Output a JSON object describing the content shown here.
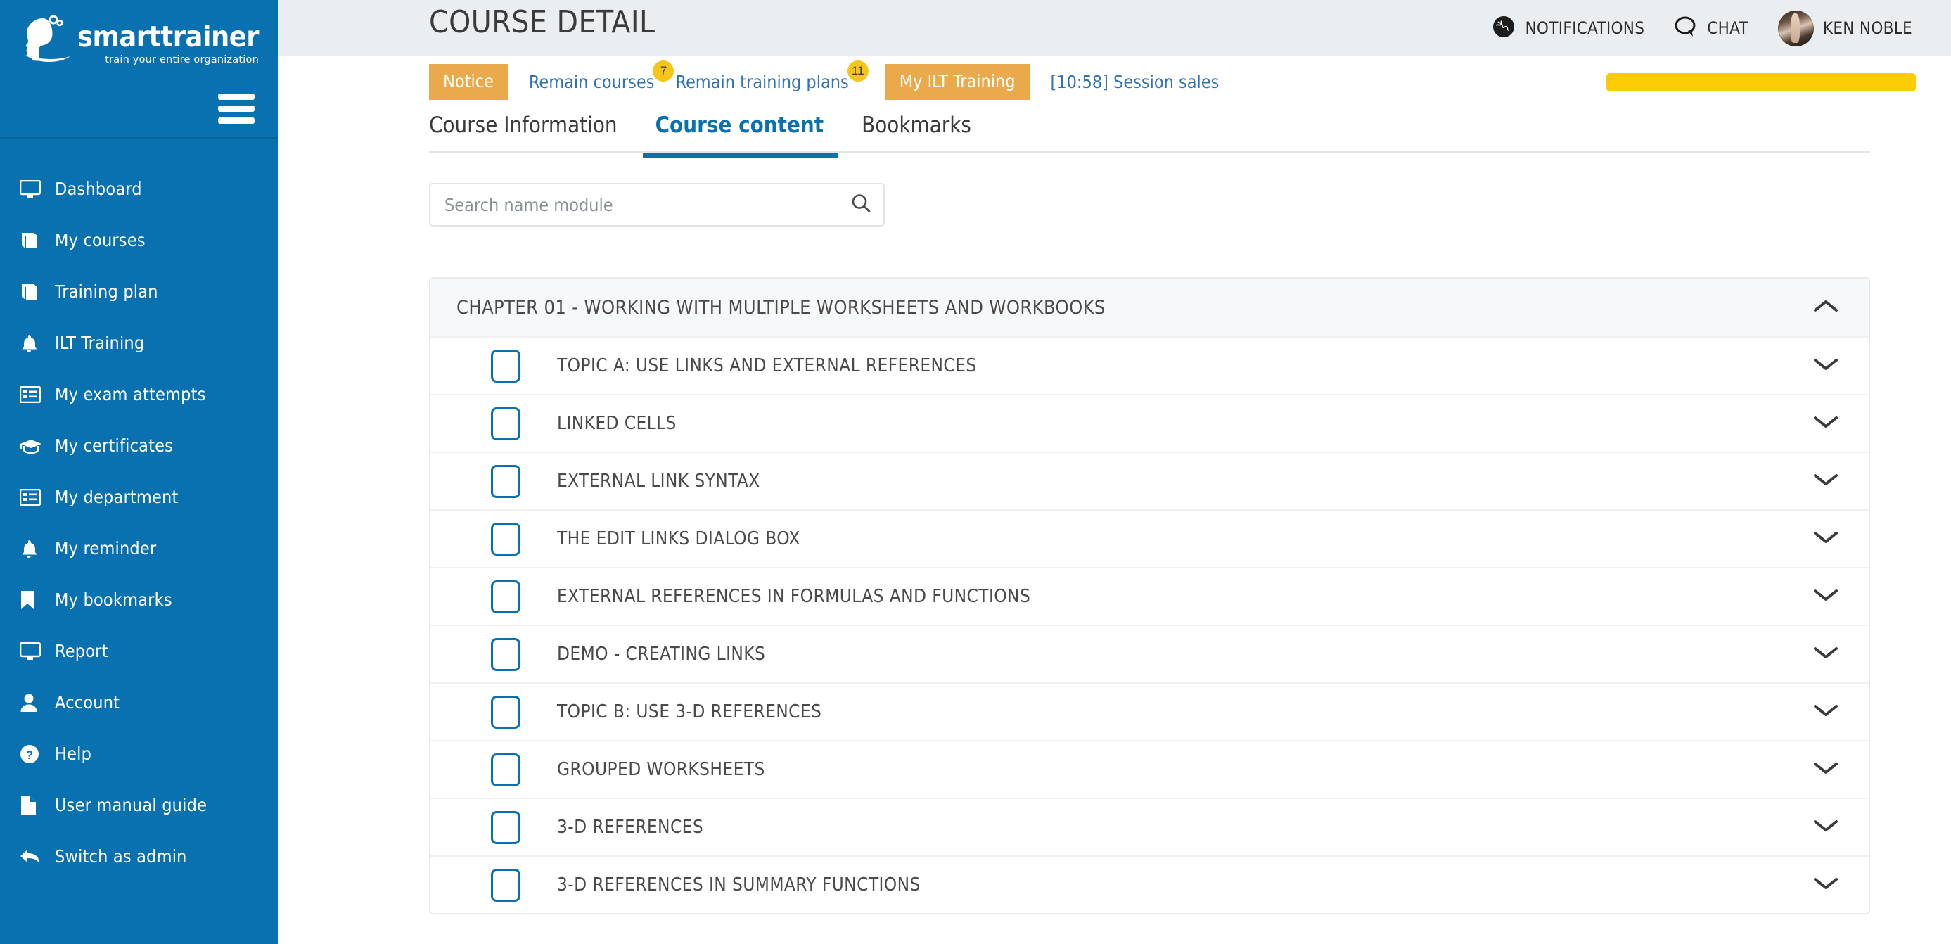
{
  "brand": {
    "name": "smarttrainer",
    "tagline": "train your entire organization"
  },
  "sidebar": {
    "items": [
      {
        "label": "Dashboard",
        "icon": "monitor-icon"
      },
      {
        "label": "My courses",
        "icon": "book-icon"
      },
      {
        "label": "Training plan",
        "icon": "book-icon"
      },
      {
        "label": "ILT Training",
        "icon": "bell-icon"
      },
      {
        "label": "My exam attempts",
        "icon": "list-icon"
      },
      {
        "label": "My certificates",
        "icon": "graduation-cap-icon"
      },
      {
        "label": "My department",
        "icon": "list-icon"
      },
      {
        "label": "My reminder",
        "icon": "bell-icon"
      },
      {
        "label": "My bookmarks",
        "icon": "bookmark-icon"
      },
      {
        "label": "Report",
        "icon": "monitor-icon"
      },
      {
        "label": "Account",
        "icon": "user-icon"
      },
      {
        "label": "Help",
        "icon": "question-circle-icon"
      },
      {
        "label": "User manual guide",
        "icon": "file-icon"
      },
      {
        "label": "Switch as admin",
        "icon": "reply-arrow-icon"
      }
    ]
  },
  "header": {
    "title": "COURSE DETAIL",
    "notifications_label": "NOTIFICATIONS",
    "chat_label": "CHAT",
    "user_name": "KEN NOBLE"
  },
  "notice_bar": {
    "notice_label": "Notice",
    "remain_courses_label": "Remain courses",
    "remain_courses_count": "7",
    "remain_training_plans_label": "Remain training plans",
    "remain_training_plans_count": "11",
    "my_ilt_training_label": "My ILT Training",
    "session_label": "[10:58] Session sales"
  },
  "tabs": [
    {
      "label": "Course Information",
      "active": false
    },
    {
      "label": "Course content",
      "active": true
    },
    {
      "label": "Bookmarks",
      "active": false
    }
  ],
  "search": {
    "placeholder": "Search name module",
    "value": ""
  },
  "accordion": {
    "chapter_title": "CHAPTER 01 - WORKING WITH MULTIPLE WORKSHEETS AND WORKBOOKS",
    "chapter_expanded": true,
    "modules": [
      {
        "label": "TOPIC A: USE LINKS AND EXTERNAL REFERENCES",
        "checked": false
      },
      {
        "label": "LINKED CELLS",
        "checked": false
      },
      {
        "label": "EXTERNAL LINK SYNTAX",
        "checked": false
      },
      {
        "label": "THE EDIT LINKS DIALOG BOX",
        "checked": false
      },
      {
        "label": "EXTERNAL REFERENCES IN FORMULAS AND FUNCTIONS",
        "checked": false
      },
      {
        "label": "DEMO - CREATING LINKS",
        "checked": false
      },
      {
        "label": "TOPIC B: USE 3-D REFERENCES",
        "checked": false
      },
      {
        "label": "GROUPED WORKSHEETS",
        "checked": false
      },
      {
        "label": "3-D REFERENCES",
        "checked": false
      },
      {
        "label": "3-D REFERENCES IN SUMMARY FUNCTIONS",
        "checked": false
      }
    ]
  },
  "colors": {
    "sidebar_blue": "#0A71B0",
    "accent_blue": "#0A71B0",
    "link_blue": "#2E74B5",
    "notice_orange": "#EAA94B",
    "badge_yellow": "#F5C518",
    "progress_yellow": "#FBCB05",
    "topbar_grey": "#EAEEF1"
  }
}
